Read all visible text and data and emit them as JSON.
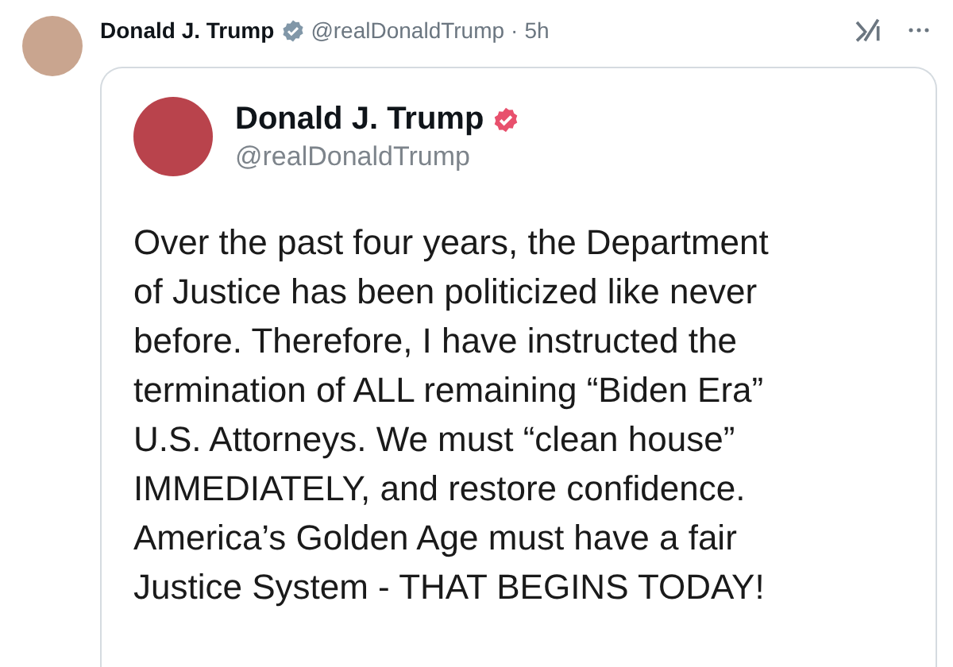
{
  "post": {
    "author": "Donald J. Trump",
    "verified": true,
    "handle": "@realDonaldTrump",
    "separator": "·",
    "time": "5h",
    "quoted": {
      "author": "Donald J. Trump",
      "verified": true,
      "handle": "@realDonaldTrump",
      "body_lines": [
        "Over the past four years, the Department",
        "of Justice has been politicized like never",
        "before. Therefore, I have instructed the",
        "termination of ALL remaining “Biden Era”",
        "U.S. Attorneys. We must “clean house”",
        "IMMEDIATELY, and restore confidence.",
        "America’s Golden Age must have a fair",
        "Justice System - THAT BEGINS TODAY!"
      ]
    }
  }
}
